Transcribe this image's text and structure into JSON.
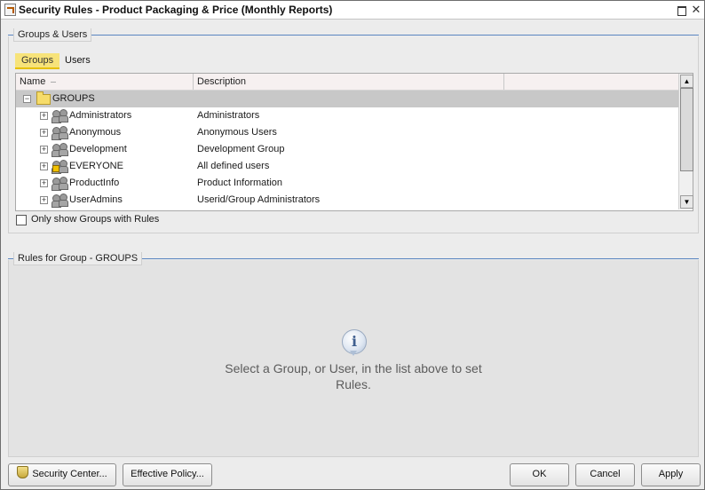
{
  "window": {
    "title": "Security Rules - Product Packaging & Price (Monthly Reports)"
  },
  "groups_users_panel": {
    "title": "Groups & Users",
    "tabs": [
      {
        "label": "Groups",
        "active": true
      },
      {
        "label": "Users",
        "active": false
      }
    ],
    "columns": [
      "Name",
      "Description"
    ],
    "root": {
      "label": "GROUPS",
      "expanded": true,
      "icon": "folder-icon"
    },
    "rows": [
      {
        "name": "Administrators",
        "description": "Administrators",
        "icon": "group-icon"
      },
      {
        "name": "Anonymous",
        "description": "Anonymous Users",
        "icon": "group-icon"
      },
      {
        "name": "Development",
        "description": "Development Group",
        "icon": "group-icon"
      },
      {
        "name": "EVERYONE",
        "description": "All defined users",
        "icon": "group-lock-icon"
      },
      {
        "name": "ProductInfo",
        "description": "Product Information",
        "icon": "group-icon"
      },
      {
        "name": "UserAdmins",
        "description": "Userid/Group Administrators",
        "icon": "group-icon"
      }
    ],
    "only_show_groups_with_rules": {
      "label": "Only show Groups with Rules",
      "checked": false
    }
  },
  "rules_panel": {
    "title": "Rules for Group - GROUPS",
    "empty_message": "Select a Group, or User, in the list above to set Rules."
  },
  "footer": {
    "security_center": "Security Center...",
    "effective_policy": "Effective Policy...",
    "ok": "OK",
    "cancel": "Cancel",
    "apply": "Apply"
  },
  "colors": {
    "active_tab": "#f7e37a",
    "group_divider": "#5a86c0",
    "selected_row": "#c8c8c8"
  }
}
